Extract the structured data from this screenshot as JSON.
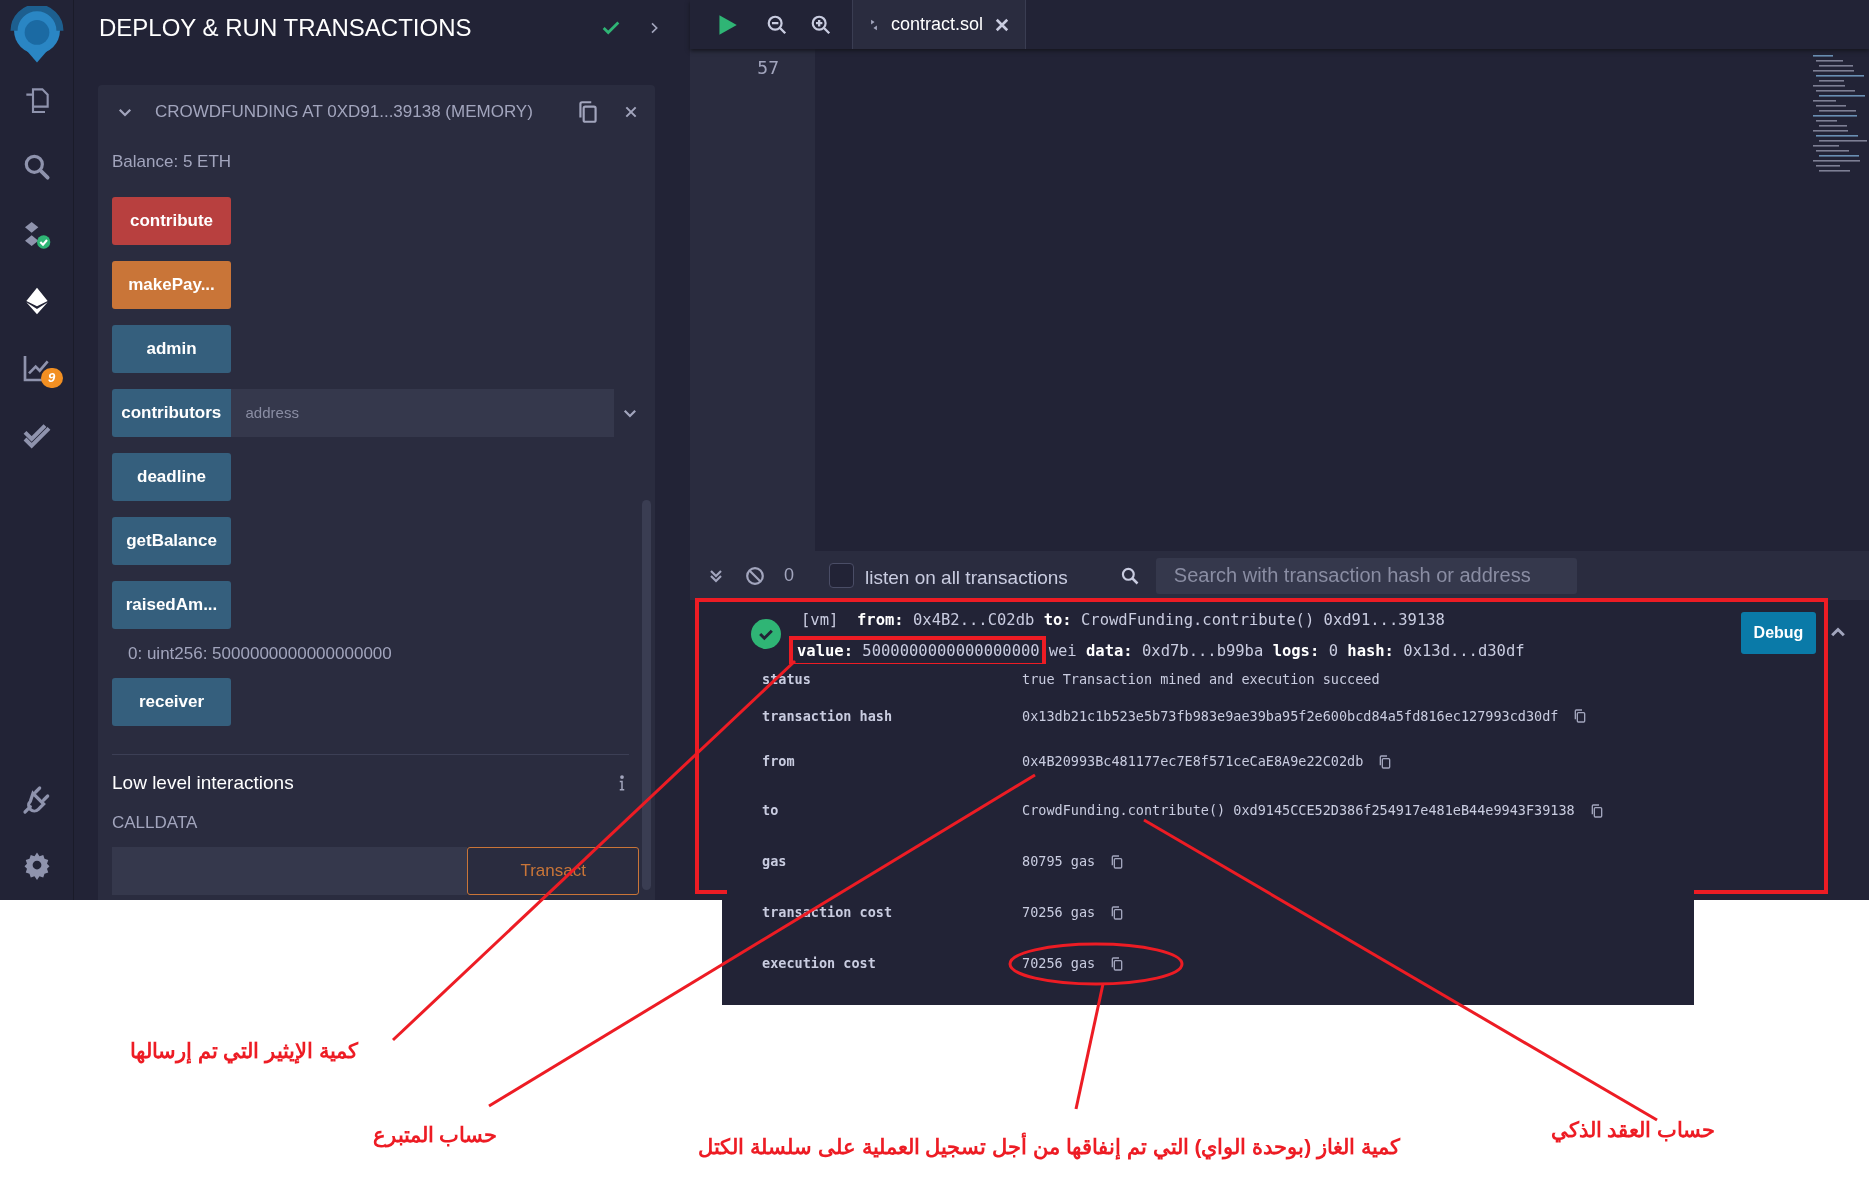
{
  "icon_bar": {
    "analytics_badge": "9"
  },
  "side_panel": {
    "title": "DEPLOY & RUN TRANSACTIONS",
    "contract": {
      "title": "CROWDFUNDING AT 0XD91...39138 (MEMORY)",
      "balance": "Balance: 5 ETH",
      "functions": [
        {
          "label": "contribute",
          "kind": "payable"
        },
        {
          "label": "makePay...",
          "kind": "transact"
        },
        {
          "label": "admin",
          "kind": "call"
        },
        {
          "label": "contributors",
          "kind": "call",
          "placeholder": "address"
        },
        {
          "label": "deadline",
          "kind": "call"
        },
        {
          "label": "getBalance",
          "kind": "call"
        },
        {
          "label": "raisedAm...",
          "kind": "call",
          "result": "0: uint256: 5000000000000000000"
        },
        {
          "label": "receiver",
          "kind": "call"
        }
      ]
    },
    "low_level": {
      "title": "Low level interactions",
      "calldata_label": "CALLDATA",
      "button": "Transact"
    }
  },
  "editor": {
    "file_tab": "contract.sol",
    "line_number": "57"
  },
  "terminal": {
    "pending_count": "0",
    "listen_label": "listen on all transactions",
    "listen_checked": false,
    "search_placeholder": "Search with transaction hash or address",
    "log": {
      "succeeded": true,
      "summary_lines": [
        "[vm]  **from:** 0x4B2...C02db **to:** CrowdFunding.contribute() 0xd91...39138"
      ],
      "highlighted_value": "**value:** 5000000000000000000",
      "summary_rest": "wei **data:** 0xd7b...b99ba **logs:** 0 **hash:** 0x13d...d30df",
      "debug_button": "Debug",
      "details": [
        {
          "label": "status",
          "value": "true Transaction mined and execution succeed",
          "copy": false
        },
        {
          "label": "transaction hash",
          "value": "0x13db21c1b523e5b73fb983e9ae39ba95f2e600bcd84a5fd816ec127993cd30df",
          "copy": true
        },
        {
          "label": "from",
          "value": "0x4B20993Bc481177ec7E8f571ceCaE8A9e22C02db",
          "copy": true
        },
        {
          "label": "to",
          "value": "CrowdFunding.contribute() 0xd9145CCE52D386f254917e481eB44e9943F39138",
          "copy": true
        },
        {
          "label": "gas",
          "value": "80795 gas",
          "copy": true
        },
        {
          "label": "transaction cost",
          "value": "70256 gas",
          "copy": true
        },
        {
          "label": "execution cost",
          "value": "70256 gas",
          "copy": true
        }
      ]
    }
  },
  "annotations": [
    {
      "text": "كمية الإيثير التي تم إرسالها"
    },
    {
      "text": "حساب العقد الذكي"
    },
    {
      "text": "كمية الغاز (بوحدة الواي) التي تم إنفاقها من أجل تسجيل العملية على سلسلة الكتل"
    },
    {
      "text": "حساب المتبرع"
    }
  ]
}
